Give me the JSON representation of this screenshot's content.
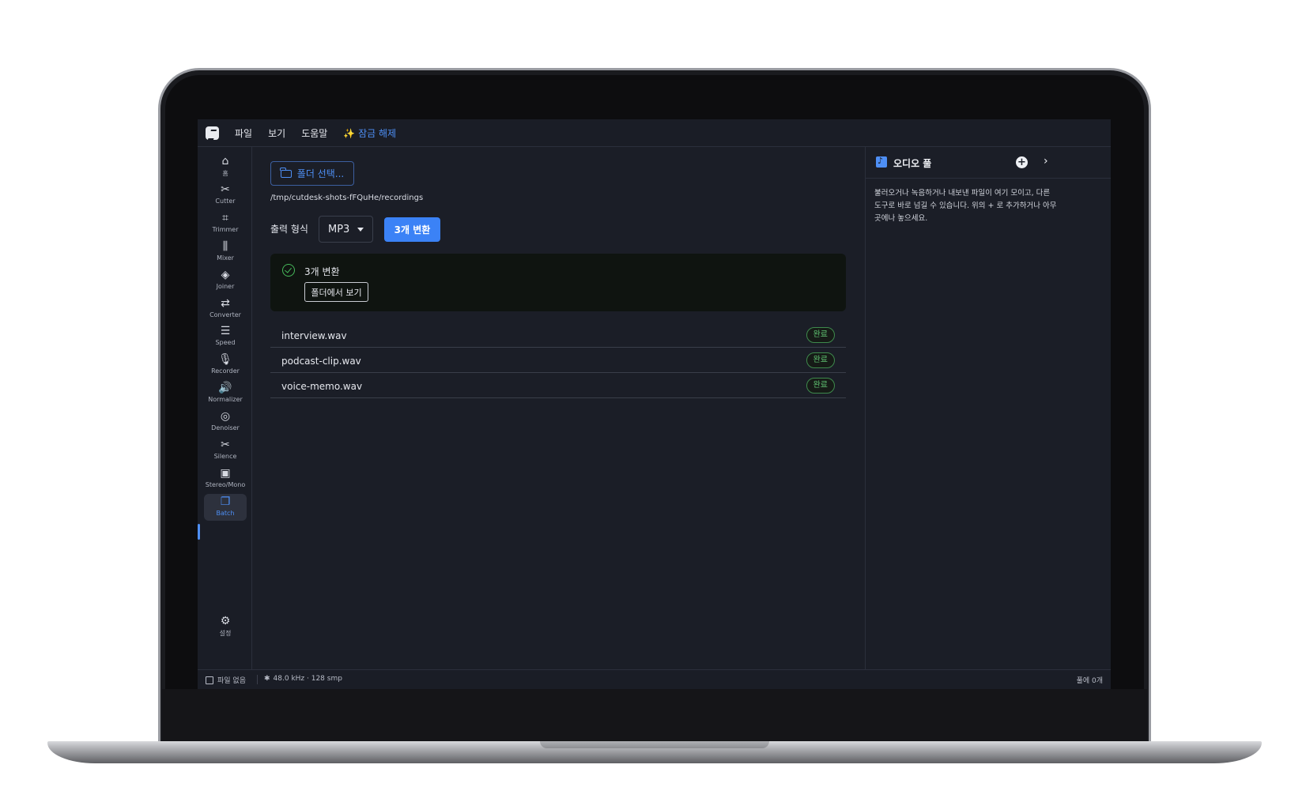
{
  "menubar": {
    "items": [
      "파일",
      "보기",
      "도움말"
    ],
    "unlock": "✨ 잠금 해제"
  },
  "sidebar": {
    "items": [
      {
        "label": "홈",
        "icon": "home-icon",
        "glyph": "⌂"
      },
      {
        "label": "Cutter",
        "icon": "scissors-icon",
        "glyph": "✂"
      },
      {
        "label": "Trimmer",
        "icon": "crop-icon",
        "glyph": "⌗"
      },
      {
        "label": "Mixer",
        "icon": "mixer-icon",
        "glyph": "⫼"
      },
      {
        "label": "Joiner",
        "icon": "layers-icon",
        "glyph": "◈"
      },
      {
        "label": "Converter",
        "icon": "swap-icon",
        "glyph": "⇄"
      },
      {
        "label": "Speed",
        "icon": "sliders-icon",
        "glyph": "☰"
      },
      {
        "label": "Recorder",
        "icon": "mic-icon",
        "glyph": "🎙"
      },
      {
        "label": "Normalizer",
        "icon": "volume-icon",
        "glyph": "🔊"
      },
      {
        "label": "Denoiser",
        "icon": "denoise-icon",
        "glyph": "◎"
      },
      {
        "label": "Silence",
        "icon": "scissors-icon",
        "glyph": "✂"
      },
      {
        "label": "Stereo/Mono",
        "icon": "speaker-icon",
        "glyph": "▣"
      },
      {
        "label": "Batch",
        "icon": "batch-icon",
        "glyph": "❐"
      }
    ],
    "settings": {
      "label": "설정",
      "icon": "gear-icon",
      "glyph": "⚙"
    },
    "active": "Batch"
  },
  "main": {
    "folder_button": "폴더 선택...",
    "path": "/tmp/cutdesk-shots-fFQuHe/recordings",
    "format_label": "출력 형식",
    "format_value": "MP3",
    "convert_button": "3개 변환",
    "result": {
      "text": "3개 변환",
      "view_button": "폴더에서 보기"
    },
    "files": [
      {
        "name": "interview.wav",
        "status": "완료"
      },
      {
        "name": "podcast-clip.wav",
        "status": "완료"
      },
      {
        "name": "voice-memo.wav",
        "status": "완료"
      }
    ]
  },
  "pool": {
    "title": "오디오 풀",
    "add": "+",
    "chevron": "›",
    "description": "불러오거나 녹음하거나 내보낸 파일이 여기 모이고, 다른 도구로 바로 넘길 수 있습니다. 위의 + 로 추가하거나 아무 곳에나 놓으세요."
  },
  "statusbar": {
    "file": "파일 없음",
    "rate_glyph": "✱",
    "rate": "48.0 kHz · 128 smp",
    "pool_count": "풀에 0개"
  },
  "colors": {
    "accent": "#3b82f6",
    "success": "#46b85a",
    "background": "#1b1e27"
  }
}
